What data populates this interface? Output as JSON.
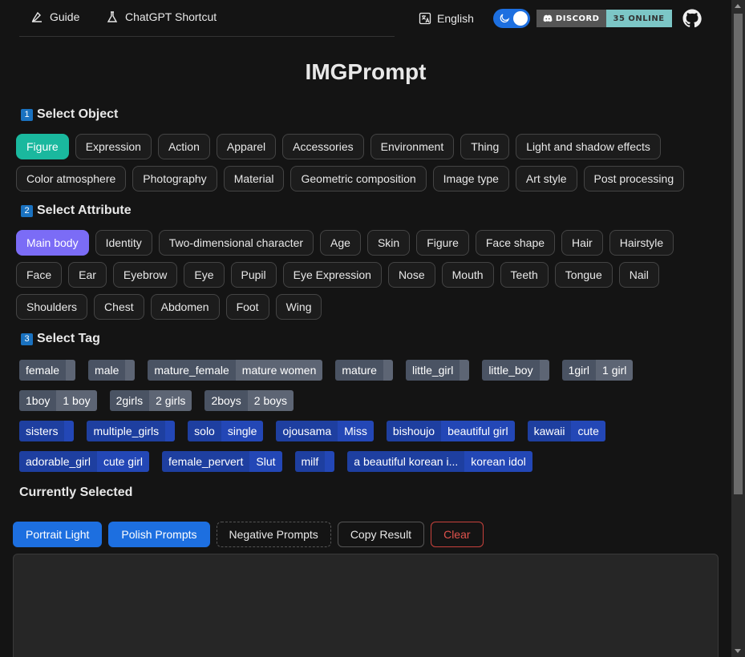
{
  "nav": {
    "guide": "Guide",
    "shortcut": "ChatGPT Shortcut",
    "language": "English",
    "discord_label": "DISCORD",
    "discord_online": "35 ONLINE"
  },
  "title": "IMGPrompt",
  "sections": {
    "object": {
      "num": "1",
      "label": "Select Object"
    },
    "attribute": {
      "num": "2",
      "label": "Select Attribute"
    },
    "tag": {
      "num": "3",
      "label": "Select Tag"
    },
    "current": "Currently Selected"
  },
  "objects": [
    "Figure",
    "Expression",
    "Action",
    "Apparel",
    "Accessories",
    "Environment",
    "Thing",
    "Light and shadow effects",
    "Color atmosphere",
    "Photography",
    "Material",
    "Geometric composition",
    "Image type",
    "Art style",
    "Post processing"
  ],
  "attributes": [
    "Main body",
    "Identity",
    "Two-dimensional character",
    "Age",
    "Skin",
    "Figure",
    "Face shape",
    "Hair",
    "Hairstyle",
    "Face",
    "Ear",
    "Eyebrow",
    "Eye",
    "Pupil",
    "Eye Expression",
    "Nose",
    "Mouth",
    "Teeth",
    "Tongue",
    "Nail",
    "Shoulders",
    "Chest",
    "Abdomen",
    "Foot",
    "Wing"
  ],
  "tags": [
    {
      "key": "female",
      "value": ""
    },
    {
      "key": "male",
      "value": ""
    },
    {
      "key": "mature_female",
      "value": "mature women"
    },
    {
      "key": "mature",
      "value": ""
    },
    {
      "key": "little_girl",
      "value": ""
    },
    {
      "key": "little_boy",
      "value": ""
    },
    {
      "key": "1girl",
      "value": "1 girl"
    },
    {
      "key": "1boy",
      "value": "1 boy"
    },
    {
      "key": "2girls",
      "value": "2 girls"
    },
    {
      "key": "2boys",
      "value": "2 boys"
    },
    {
      "key": "sisters",
      "value": ""
    },
    {
      "key": "multiple_girls",
      "value": ""
    },
    {
      "key": "solo",
      "value": "single"
    },
    {
      "key": "ojousama",
      "value": "Miss"
    },
    {
      "key": "bishoujo",
      "value": "beautiful girl"
    },
    {
      "key": "kawaii",
      "value": "cute"
    },
    {
      "key": "adorable_girl",
      "value": "cute girl"
    },
    {
      "key": "female_pervert",
      "value": "Slut"
    },
    {
      "key": "milf",
      "value": ""
    },
    {
      "key": "a beautiful korean i...",
      "value": "korean idol"
    }
  ],
  "actions": {
    "portrait": "Portrait Light",
    "polish": "Polish Prompts",
    "negative": "Negative Prompts",
    "copy": "Copy Result",
    "clear": "Clear"
  },
  "result": "",
  "colors": {
    "accent": "#1d6fe0",
    "teal": "#1ab89e",
    "purple": "#7b6cf6",
    "tag_blue": "#2347b6",
    "tag_gray": "#5d6574",
    "danger": "#e0524c"
  }
}
